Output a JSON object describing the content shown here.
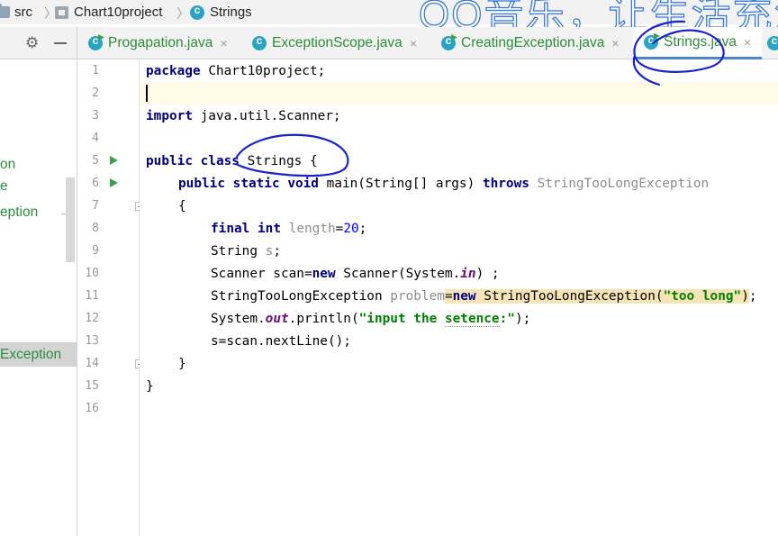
{
  "breadcrumb": {
    "items": [
      "src",
      "Chart10project",
      "Strings"
    ]
  },
  "watermark": "QQ音乐，让生活充满",
  "tabs": [
    {
      "label": "Progapation.java",
      "active": false
    },
    {
      "label": "ExceptionScope.java",
      "active": false
    },
    {
      "label": "CreatingException.java",
      "active": false
    },
    {
      "label": "Strings.java",
      "active": true
    }
  ],
  "tab_close_glyph": "×",
  "project_panel": {
    "items": [
      "on",
      "e",
      "eption",
      "Exception"
    ]
  },
  "gutter": {
    "line_numbers": [
      "1",
      "2",
      "3",
      "4",
      "5",
      "6",
      "7",
      "8",
      "9",
      "10",
      "11",
      "12",
      "13",
      "14",
      "15",
      "16"
    ]
  },
  "code": {
    "l1": {
      "kw": "package",
      "rest": " Chart10project;"
    },
    "l3": {
      "kw": "import",
      "rest": " java.util.Scanner;"
    },
    "l5": {
      "kw1": "public",
      "kw2": "class",
      "rest": " Strings {"
    },
    "l6": {
      "kw1": "public",
      "kw2": "static",
      "kw3": "void",
      "mid": " main(String[] args) ",
      "kw4": "throws",
      "exc": "StringTooLongException"
    },
    "l7": {
      "text": "{"
    },
    "l8": {
      "kw1": "final",
      "kw2": "int",
      "var": "length",
      "eq": "=",
      "num": "20",
      "end": ";"
    },
    "l9": {
      "type": "String ",
      "var": "s",
      "end": ";"
    },
    "l10": {
      "pre": "Scanner scan=",
      "kw": "new",
      "mid": " Scanner(System.",
      "fld": "in",
      "end": ") ;"
    },
    "l11": {
      "pre": "StringTooLongException ",
      "var": "problem",
      "eq": "=",
      "kw": "new",
      "ctor": " StringTooLongException",
      "lp": "(",
      "str": "\"too long\"",
      "rp": ")",
      "end": ";"
    },
    "l12": {
      "pre": "System.",
      "fld": "out",
      "mid": ".println(",
      "str_a": "\"input the ",
      "str_b": "setence",
      "str_c": ":\"",
      "end": ");"
    },
    "l13": {
      "text": "s=scan.nextLine();"
    },
    "l14": {
      "text": "}"
    },
    "l15": {
      "text": "}"
    }
  },
  "colors": {
    "keyword": "#000080",
    "string": "#008000",
    "number": "#0000ff",
    "tab_text": "#2d8c3c",
    "annotation": "#1a23c8"
  }
}
